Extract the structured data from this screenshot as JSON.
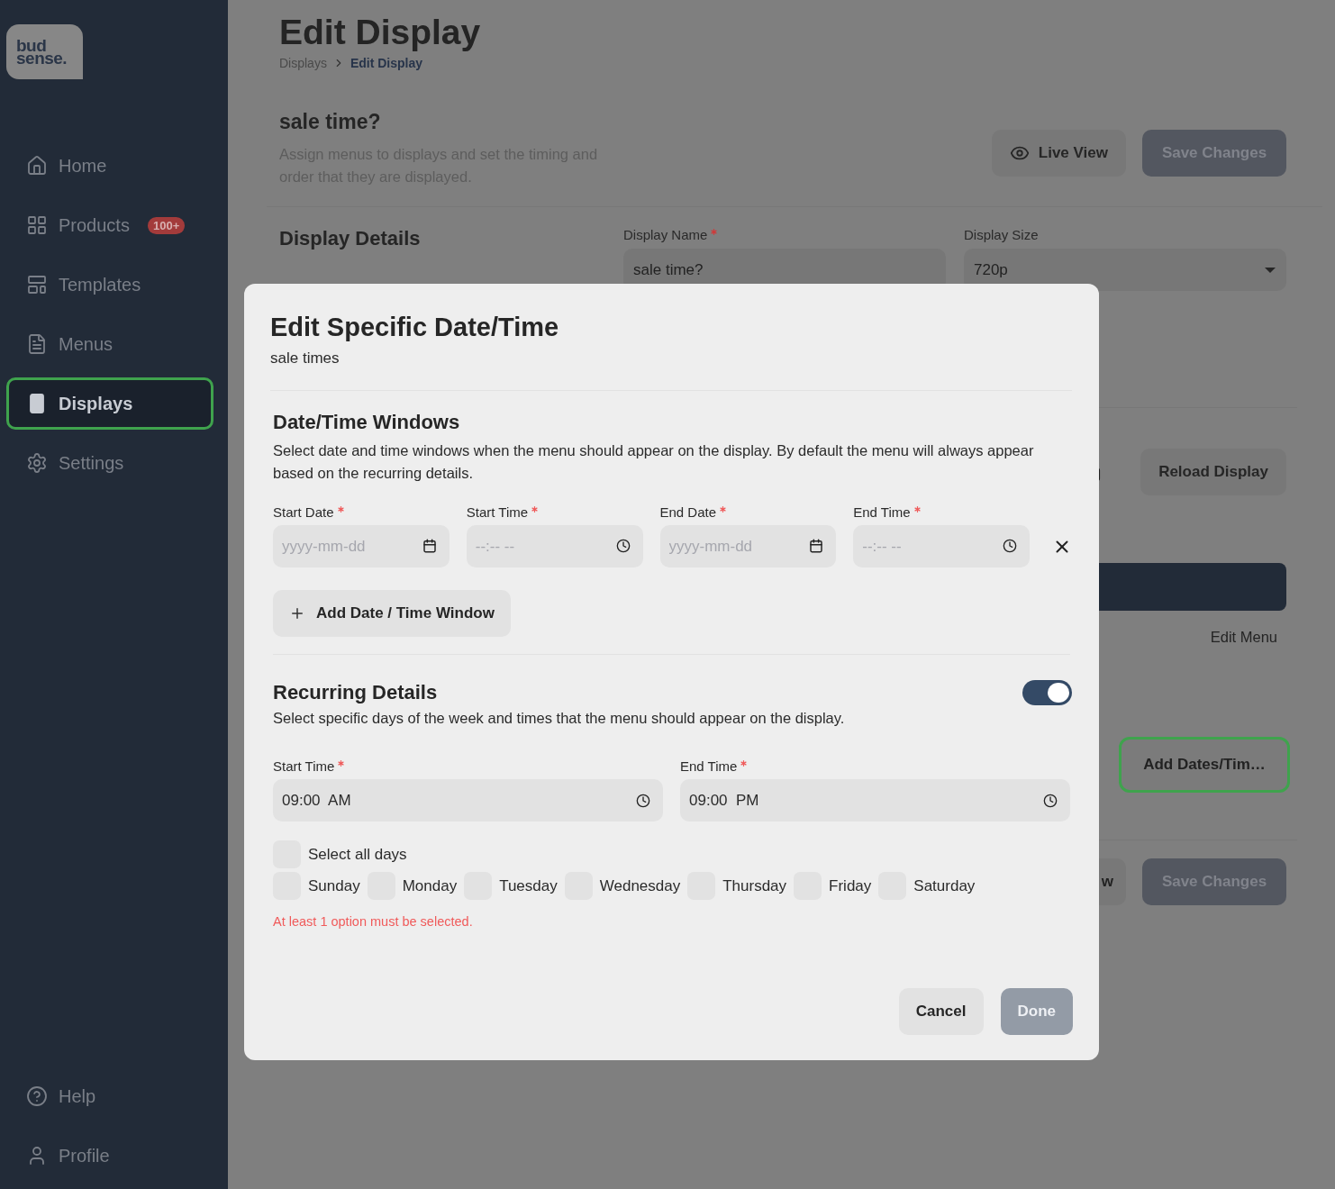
{
  "sidebar": {
    "logo": [
      "bud",
      "sense."
    ],
    "items": [
      {
        "label": "Home",
        "selected": false
      },
      {
        "label": "Products",
        "selected": false,
        "badge": "100+"
      },
      {
        "label": "Templates",
        "selected": false
      },
      {
        "label": "Menus",
        "selected": false
      },
      {
        "label": "Displays",
        "selected": true
      },
      {
        "label": "Settings",
        "selected": false
      }
    ],
    "footer_items": [
      {
        "label": "Help",
        "selected": false
      },
      {
        "label": "Profile",
        "selected": false
      }
    ]
  },
  "page": {
    "title": "Edit Display",
    "breadcrumb": [
      "Displays",
      "Edit Display"
    ],
    "name": "sale time?",
    "description": "Assign menus to displays and set the timing and order that they are displayed.",
    "live_view_button": "Live View",
    "save_button": "Save Changes",
    "section_title": "Display Details",
    "fields": [
      {
        "label": "Display Name",
        "required": true,
        "value": "sale time?",
        "kind": "text"
      },
      {
        "label": "Display Size",
        "value": "720p",
        "kind": "select"
      }
    ],
    "reload_button": "Reload Display",
    "edit_menu_link": "Edit Menu",
    "add_dates_button": "Add Dates/Tim…",
    "partial_button": "w",
    "bottom_save_button": "Save Changes"
  },
  "modal": {
    "title": "Edit Specific Date/Time",
    "subtitle": "sale times",
    "windows_section": {
      "title": "Date/Time Windows",
      "description": "Select date and time windows when the menu should appear on the display. By default the menu will always appear based on the recurring details.",
      "fields": [
        {
          "label": "Start Date",
          "required": true,
          "placeholder": "yyyy-mm-dd",
          "kind": "date"
        },
        {
          "label": "Start Time",
          "required": true,
          "placeholder": "--:-- --",
          "kind": "time"
        },
        {
          "label": "End Date",
          "required": true,
          "placeholder": "yyyy-mm-dd",
          "kind": "date"
        },
        {
          "label": "End Time",
          "required": true,
          "placeholder": "--:-- --",
          "kind": "time"
        }
      ],
      "add_button": "Add Date / Time Window"
    },
    "recurring_section": {
      "title": "Recurring Details",
      "on": true,
      "description": "Select specific days of the week and times that the menu should appear on the display.",
      "fields": [
        {
          "label": "Start Time",
          "required": true,
          "value": "09:00  AM",
          "kind": "time"
        },
        {
          "label": "End Time",
          "required": true,
          "value": "09:00  PM",
          "kind": "time"
        }
      ],
      "select_all": {
        "label": "Select all days",
        "checked": false
      },
      "days": [
        {
          "label": "Sunday",
          "checked": false
        },
        {
          "label": "Monday",
          "checked": false
        },
        {
          "label": "Tuesday",
          "checked": false
        },
        {
          "label": "Wednesday",
          "checked": false
        },
        {
          "label": "Thursday",
          "checked": false
        },
        {
          "label": "Friday",
          "checked": false
        },
        {
          "label": "Saturday",
          "checked": false
        }
      ],
      "error": "At least 1 option must be selected."
    },
    "cancel_button": "Cancel",
    "done_button": "Done"
  }
}
